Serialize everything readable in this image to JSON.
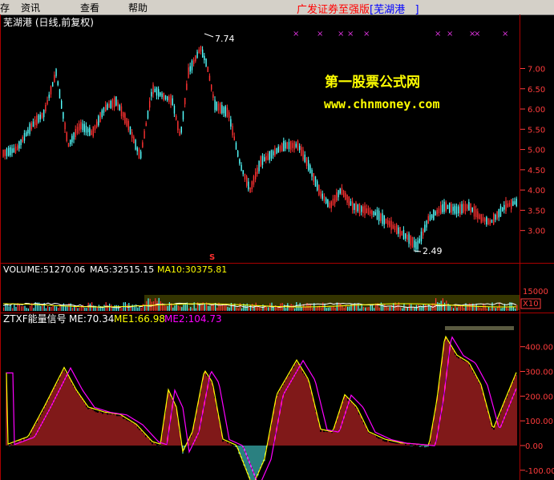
{
  "menu": {
    "items": [
      "存",
      "资讯",
      "查看",
      "帮助"
    ],
    "promo_text": "广发证券至强版",
    "promo_bracket_open": "[",
    "promo_stock": "芜湖港",
    "promo_bracket_close": "]"
  },
  "price_panel": {
    "title": "芜湖港 (日线,前复权)",
    "high_label": "7.74",
    "low_label": "2.49",
    "signal_label": "S",
    "watermark_line1": "第一股票公式网",
    "watermark_line2": "www.chnmoney.com",
    "y_ticks": [
      "7.00",
      "6.50",
      "6.00",
      "5.50",
      "5.00",
      "4.50",
      "4.00",
      "3.50",
      "3.00"
    ],
    "marker_glyph": "×"
  },
  "volume_panel": {
    "volume_label": "VOLUME:51270.06",
    "ma5_label": "MA5:32515.15",
    "ma10_label": "MA10:30375.81",
    "y_tick": "15000",
    "unit_label": "X10"
  },
  "indicator_panel": {
    "name_label": "ZTXF能量信号",
    "me_label": "ME:70.34",
    "me1_label": "ME1:66.98",
    "me2_label": "ME2:104.73",
    "y_ticks": [
      "400.00",
      "300.00",
      "200.00",
      "100.00",
      "0.00",
      "-100.00"
    ]
  },
  "colors": {
    "up": "#ff3232",
    "down": "#54ffff",
    "frame": "#aa0000",
    "axis_text": "#ff3c3c",
    "ma_white": "#ffffff",
    "ma_yellow": "#ffff00",
    "ma_magenta": "#ff00ff",
    "watermark": "#ffff00"
  },
  "chart_data": {
    "type": "candlestick",
    "price_ylim": [
      2.4,
      7.9
    ],
    "indicator_ylim": [
      -120,
      480
    ],
    "price_high": 7.74,
    "price_low": 2.49,
    "latest": {
      "volume": 51270.06,
      "volume_ma5": 32515.15,
      "volume_ma10": 30375.81,
      "me": 70.34,
      "me1": 66.98,
      "me2": 104.73
    }
  }
}
